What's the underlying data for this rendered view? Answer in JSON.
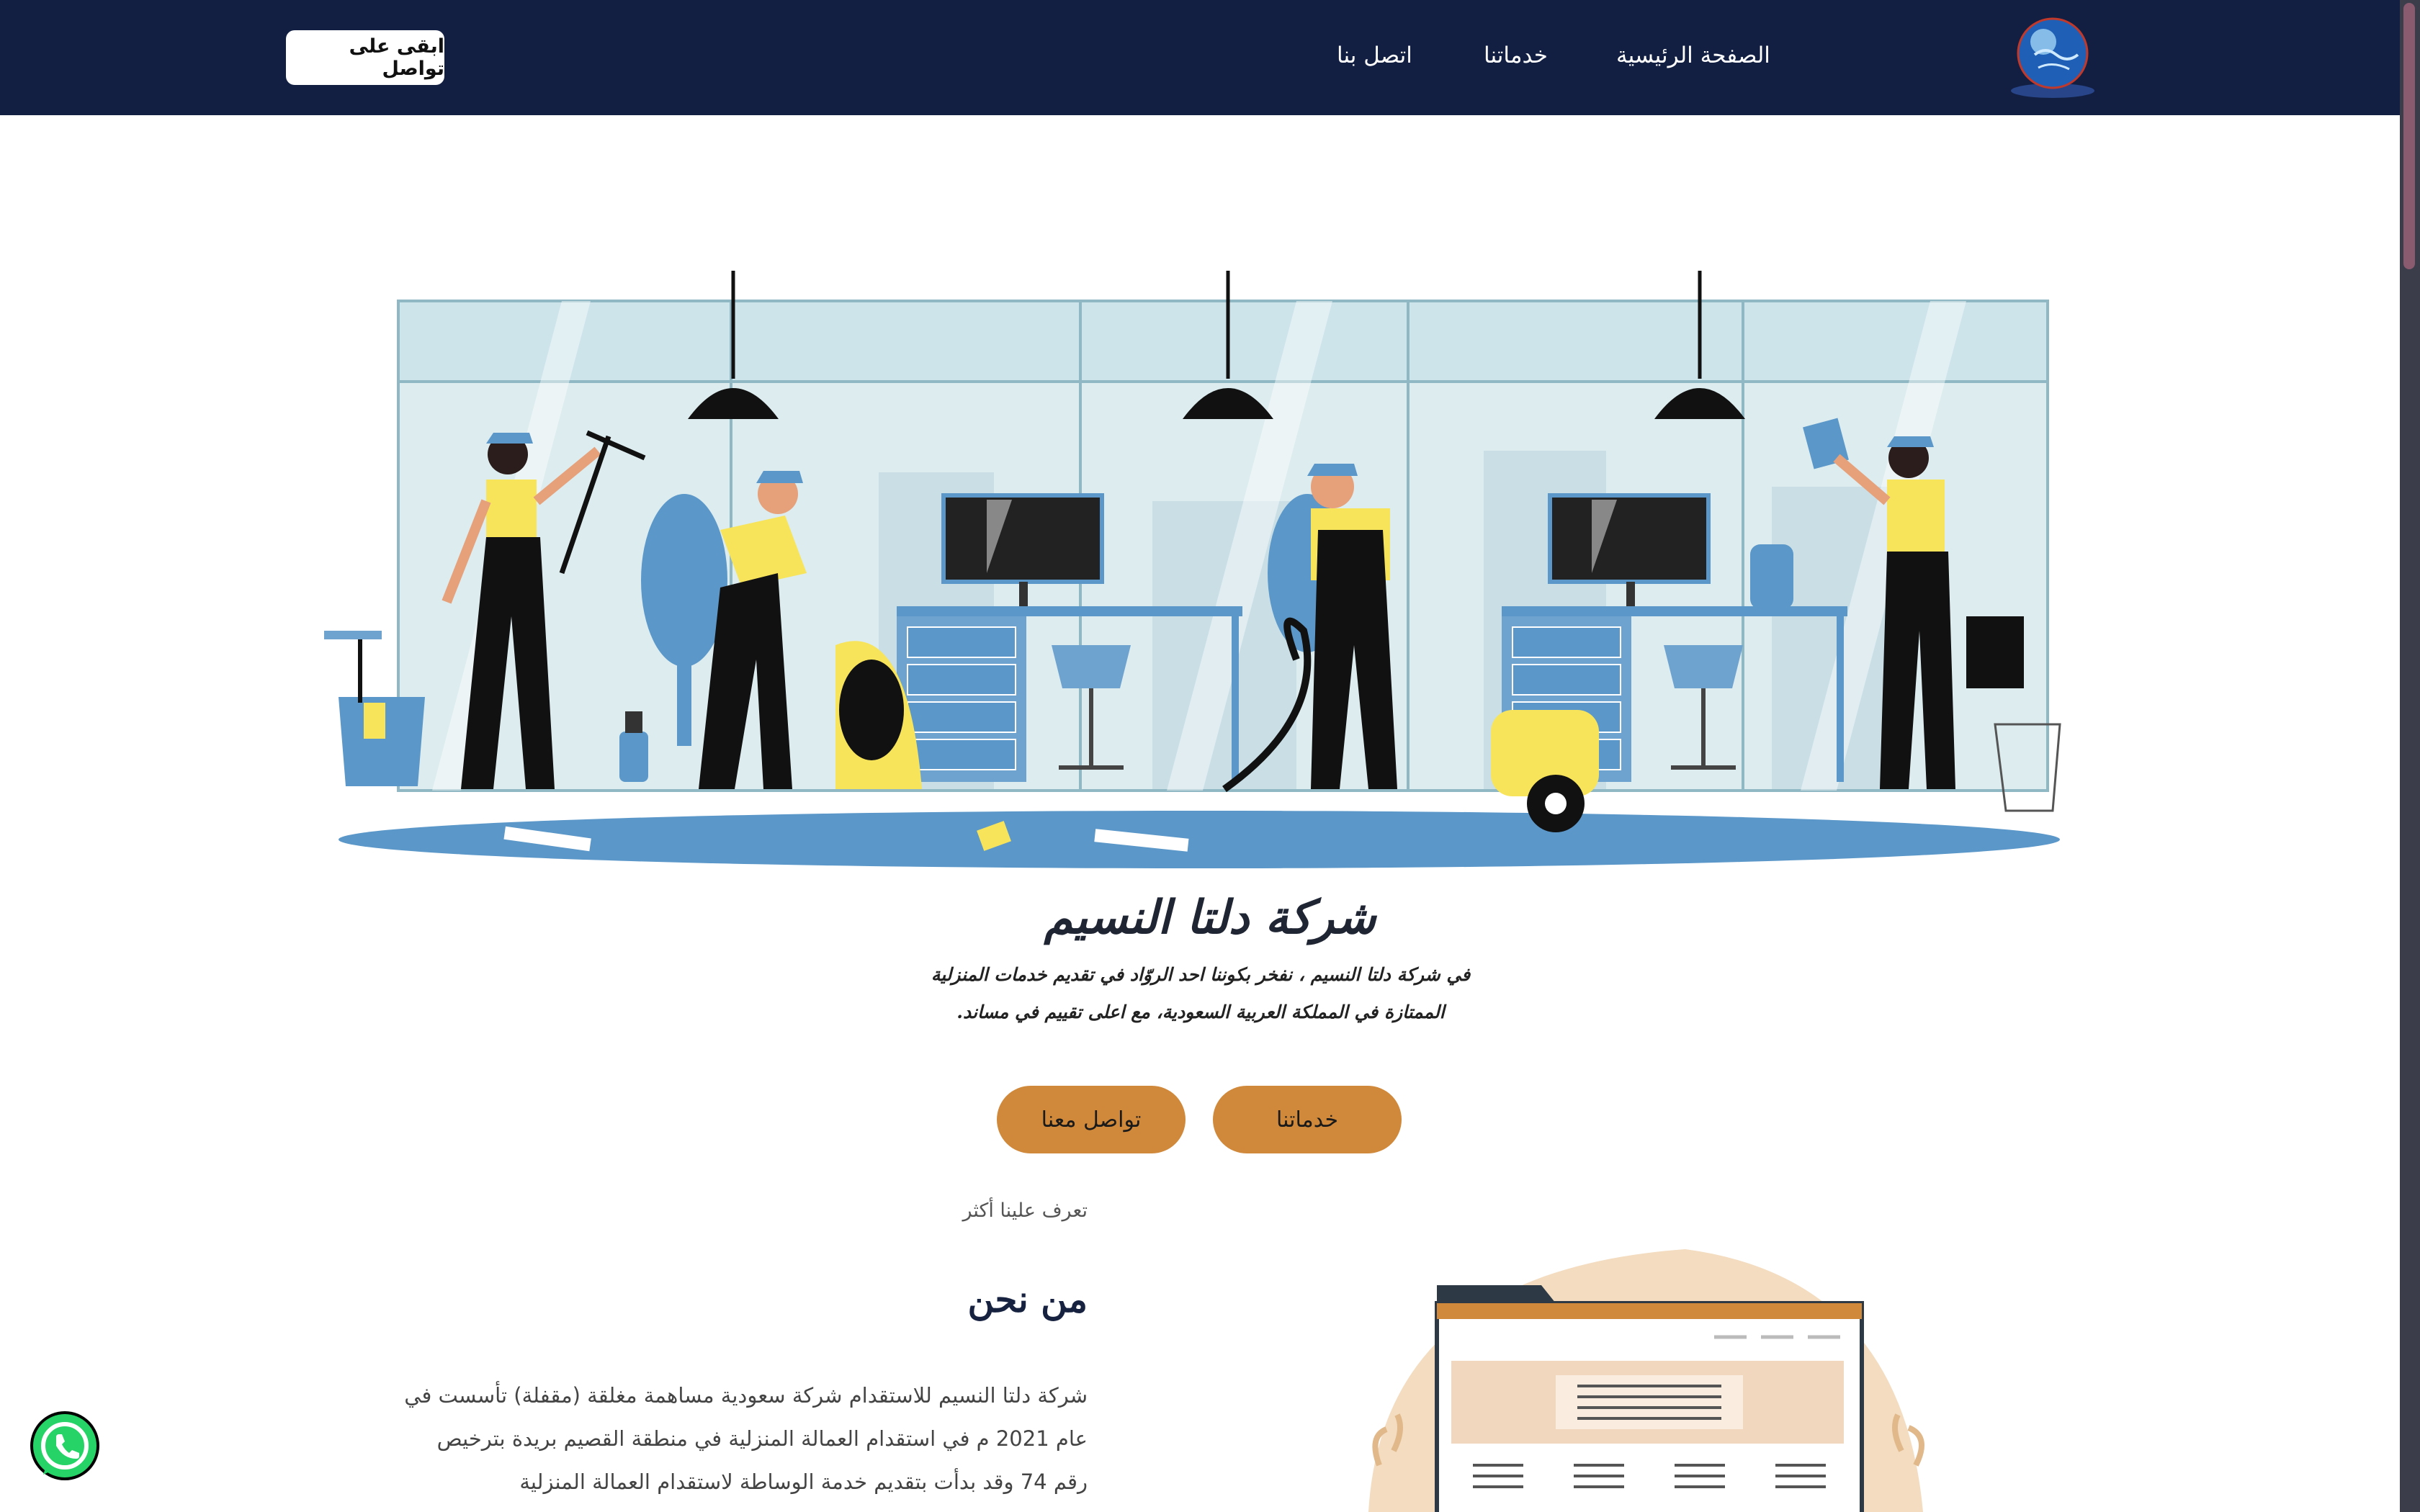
{
  "nav": {
    "home": "الصفحة الرئيسية",
    "services": "خدماتنا",
    "contact": "اتصل بنا",
    "stay_in_touch": "ابقى على تواصل"
  },
  "hero": {
    "title": "شركة دلتا النسيم",
    "description": "في شركة دلتا النسيم ، نفخر بكوننا احد الروّاد في تقديم خدمات المنزلية الممتازة في المملكة العربية السعودية، مع اعلى تقييم في مساند.",
    "btn_services": "خدماتنا",
    "btn_contact": "تواصل معنا"
  },
  "about": {
    "kicker": "تعرف علينا أكثر",
    "title": "من نحن",
    "text": "شركة دلتا النسيم للاستقدام شركة سعودية مساهمة مغلقة (مقفلة) تأسست في عام 2021 م في استقدام العمالة المنزلية في منطقة القصيم بريدة بترخيص رقم 74 وقد بدأت بتقديم خدمة الوساطة لاستقدام العمالة المنزلية"
  },
  "colors": {
    "navbar": "#121f42",
    "accent": "#d0883a",
    "sky": "#dcecef",
    "floor": "#5b98c9",
    "uniform_yellow": "#f7e45a"
  },
  "icons": {
    "logo": "globe-logo-icon",
    "whatsapp": "whatsapp-icon"
  }
}
